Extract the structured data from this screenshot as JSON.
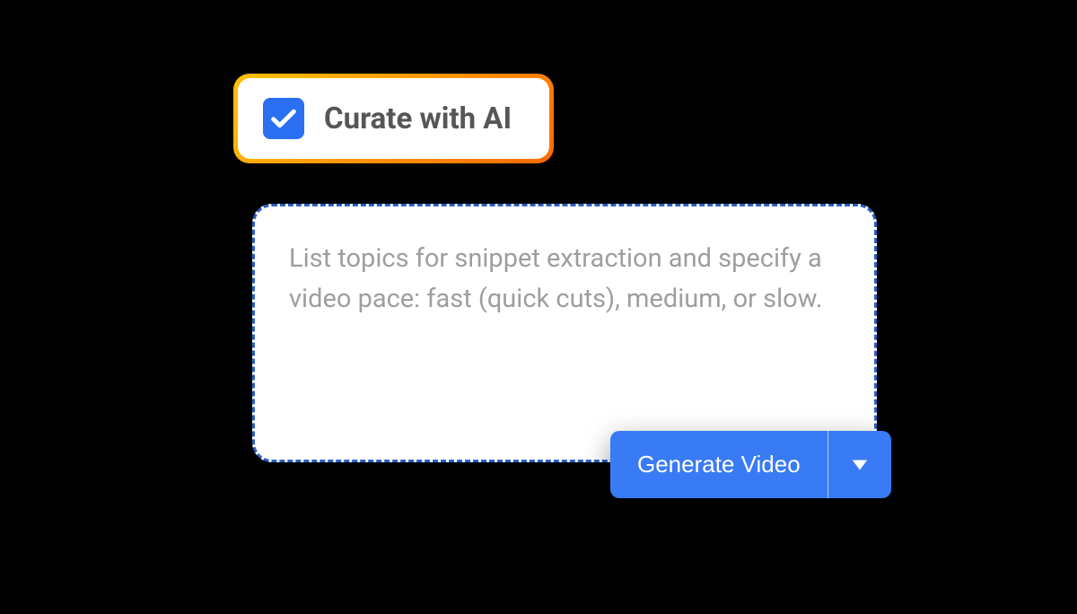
{
  "curate": {
    "label": "Curate with AI",
    "checked": true
  },
  "prompt": {
    "placeholder": "List topics for snippet extraction and specify a video pace: fast (quick cuts), medium, or slow."
  },
  "generate": {
    "label": "Generate Video"
  },
  "colors": {
    "accent_blue": "#397BF5",
    "checkbox_blue": "#2B6FF3",
    "border_blue": "#2B5FC7",
    "gradient_start": "#FFC107",
    "gradient_end": "#FF6B00",
    "text_dark": "#565656",
    "text_placeholder": "#9E9E9E"
  }
}
